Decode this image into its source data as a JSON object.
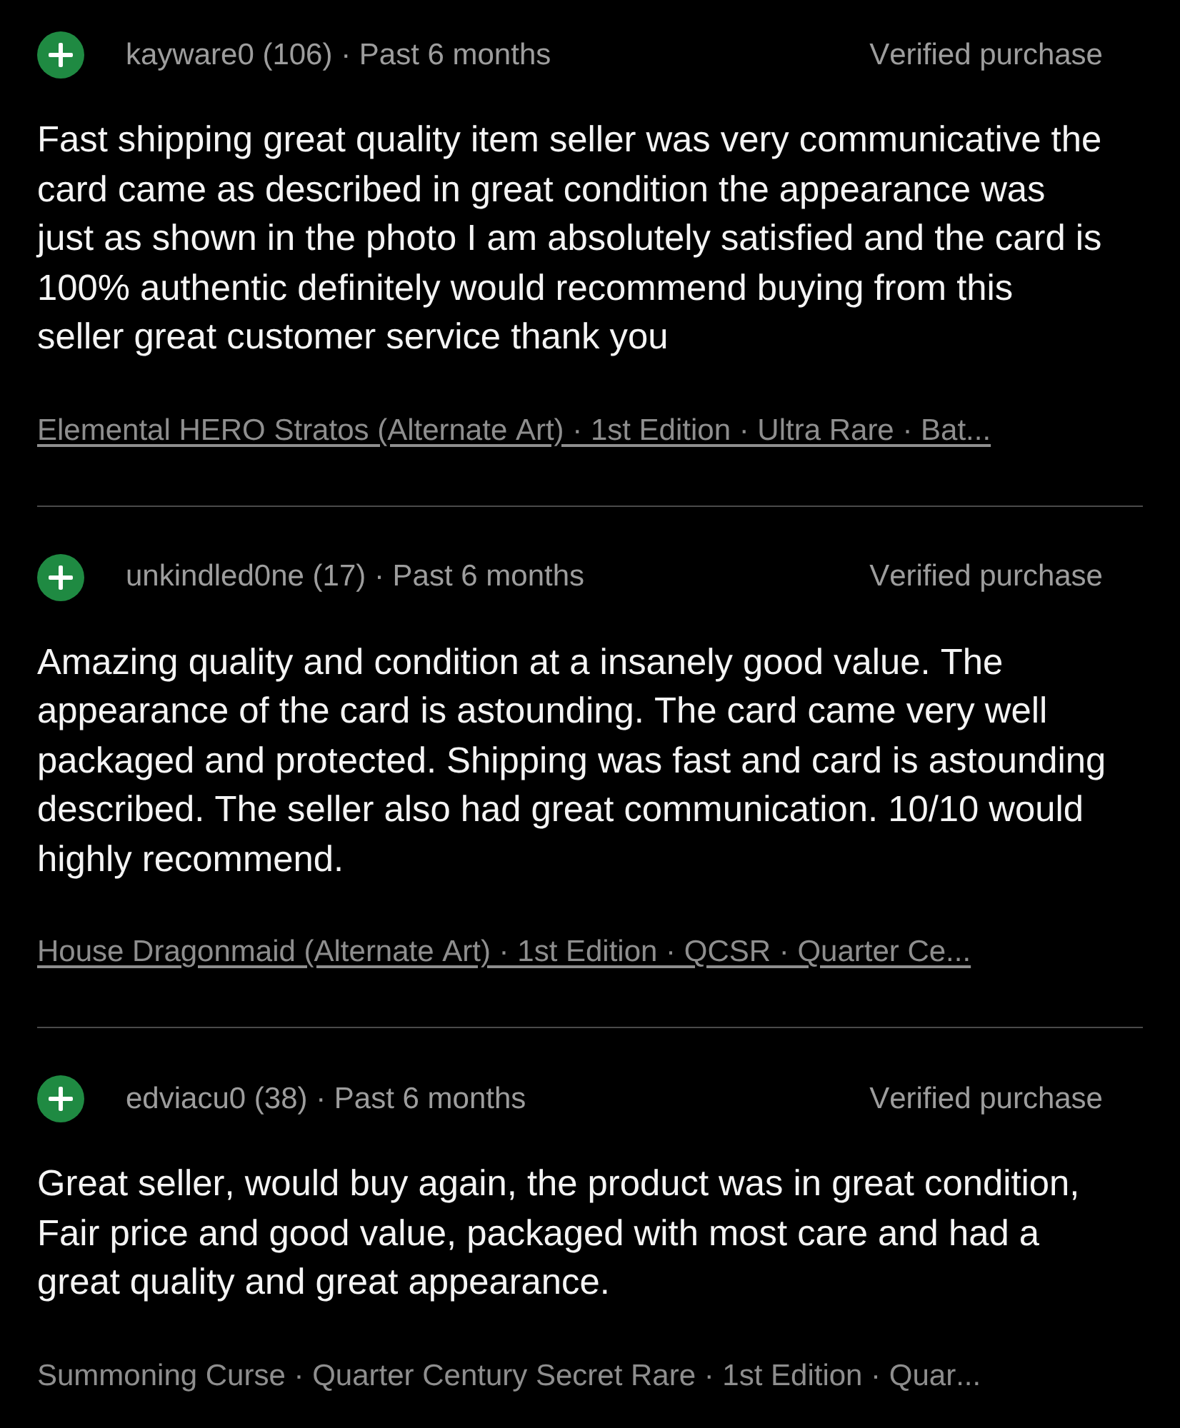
{
  "reviews": [
    {
      "kind": "positive",
      "reviewer": "kayware0 (106) · Past 6 months",
      "badge": "Verified purchase",
      "text": "Fast shipping great quality item seller was very communicative the card came as described in great condition the appearance was just as shown in the photo I am absolutely satisfied and the card is 100% authentic definitely would recommend buying from this seller great customer service thank you",
      "item": "Elemental HERO Stratos (Alternate Art) · 1st Edition · Ultra Rare · Bat...",
      "item_linked": true
    },
    {
      "kind": "positive",
      "reviewer": "unkindled0ne (17) · Past 6 months",
      "badge": "Verified purchase",
      "text": "Amazing quality and condition at a insanely good value. The appearance of the card is astounding. The card came very well packaged and protected. Shipping was fast and card is astounding described. The seller also had great communication. 10/10 would highly recommend.",
      "item": "House Dragonmaid (Alternate Art) · 1st Edition · QCSR · Quarter Ce...",
      "item_linked": true
    },
    {
      "kind": "positive",
      "reviewer": "edviacu0 (38) · Past 6 months",
      "badge": "Verified purchase",
      "text": "Great seller, would buy again, the product was in great condition, Fair price and good value, packaged with most care and had a great quality and great appearance.",
      "item": "Summoning Curse · Quarter Century Secret Rare · 1st Edition · Quar...",
      "item_linked": false
    }
  ]
}
